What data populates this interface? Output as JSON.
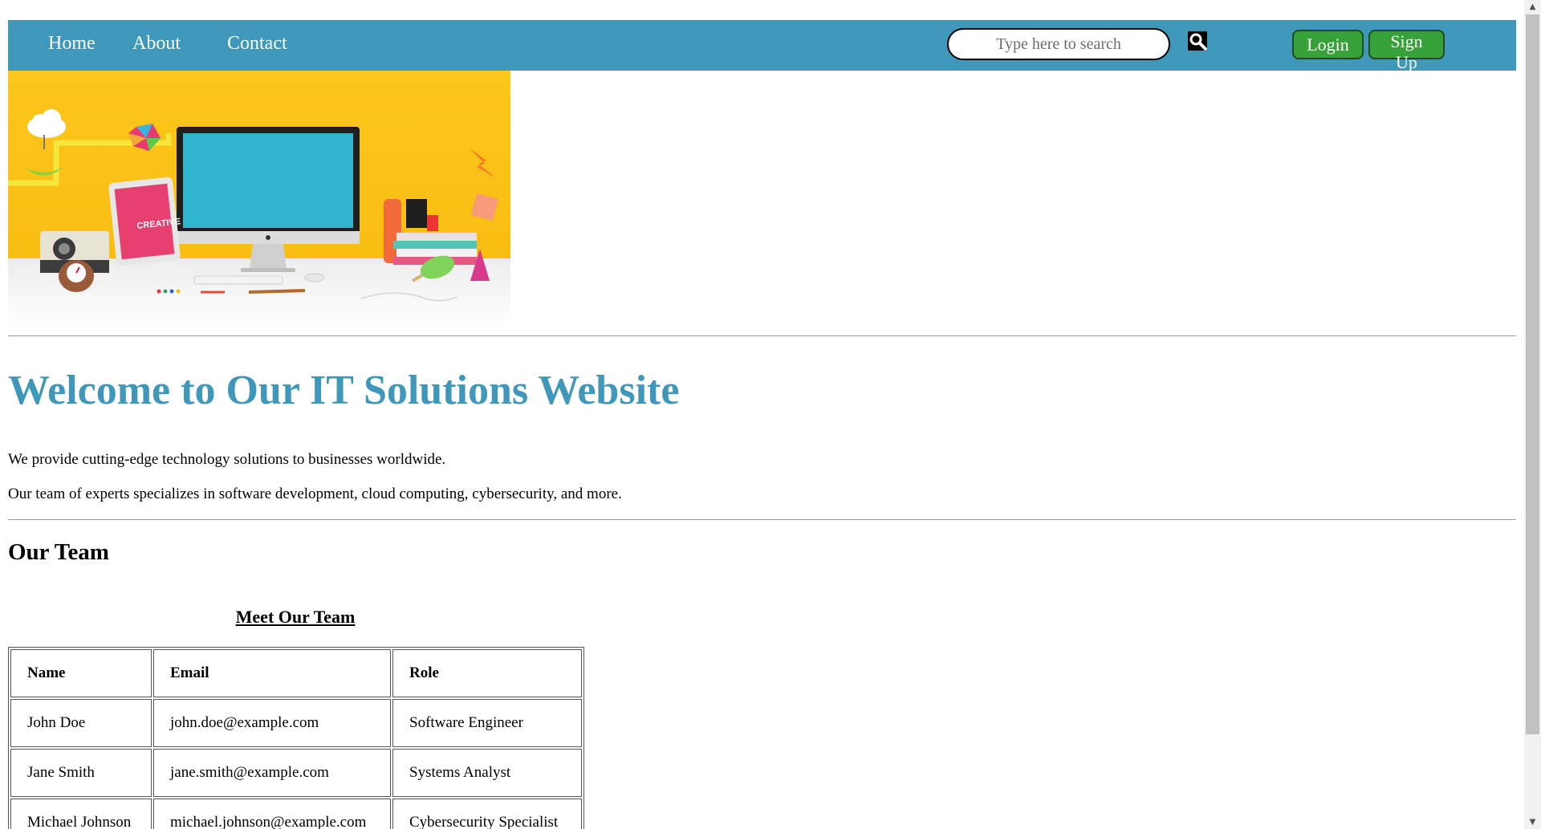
{
  "nav": {
    "links": [
      "Home",
      "About",
      "Contact"
    ],
    "search_placeholder": "Type here to search",
    "login_label": "Login",
    "signup_label": "Sign Up",
    "icons": {
      "search": "search-icon"
    }
  },
  "hero": {
    "icon": "workspace-illustration",
    "tablet_text": "CREATIVE"
  },
  "main": {
    "title": "Welcome to Our IT Solutions Website",
    "paragraphs": [
      "We provide cutting-edge technology solutions to businesses worldwide.",
      "Our team of experts specializes in software development, cloud computing, cybersecurity, and more."
    ]
  },
  "team": {
    "heading": "Our Team",
    "caption": "Meet Our Team",
    "columns": [
      "Name",
      "Email",
      "Role"
    ],
    "rows": [
      [
        "John Doe",
        "john.doe@example.com",
        "Software Engineer"
      ],
      [
        "Jane Smith",
        "jane.smith@example.com",
        "Systems Analyst"
      ],
      [
        "Michael Johnson",
        "michael.johnson@example.com",
        "Cybersecurity Specialist"
      ]
    ]
  },
  "colors": {
    "navbar": "#3f97ba",
    "title": "#3f97ba",
    "auth_button": "#35a138"
  }
}
